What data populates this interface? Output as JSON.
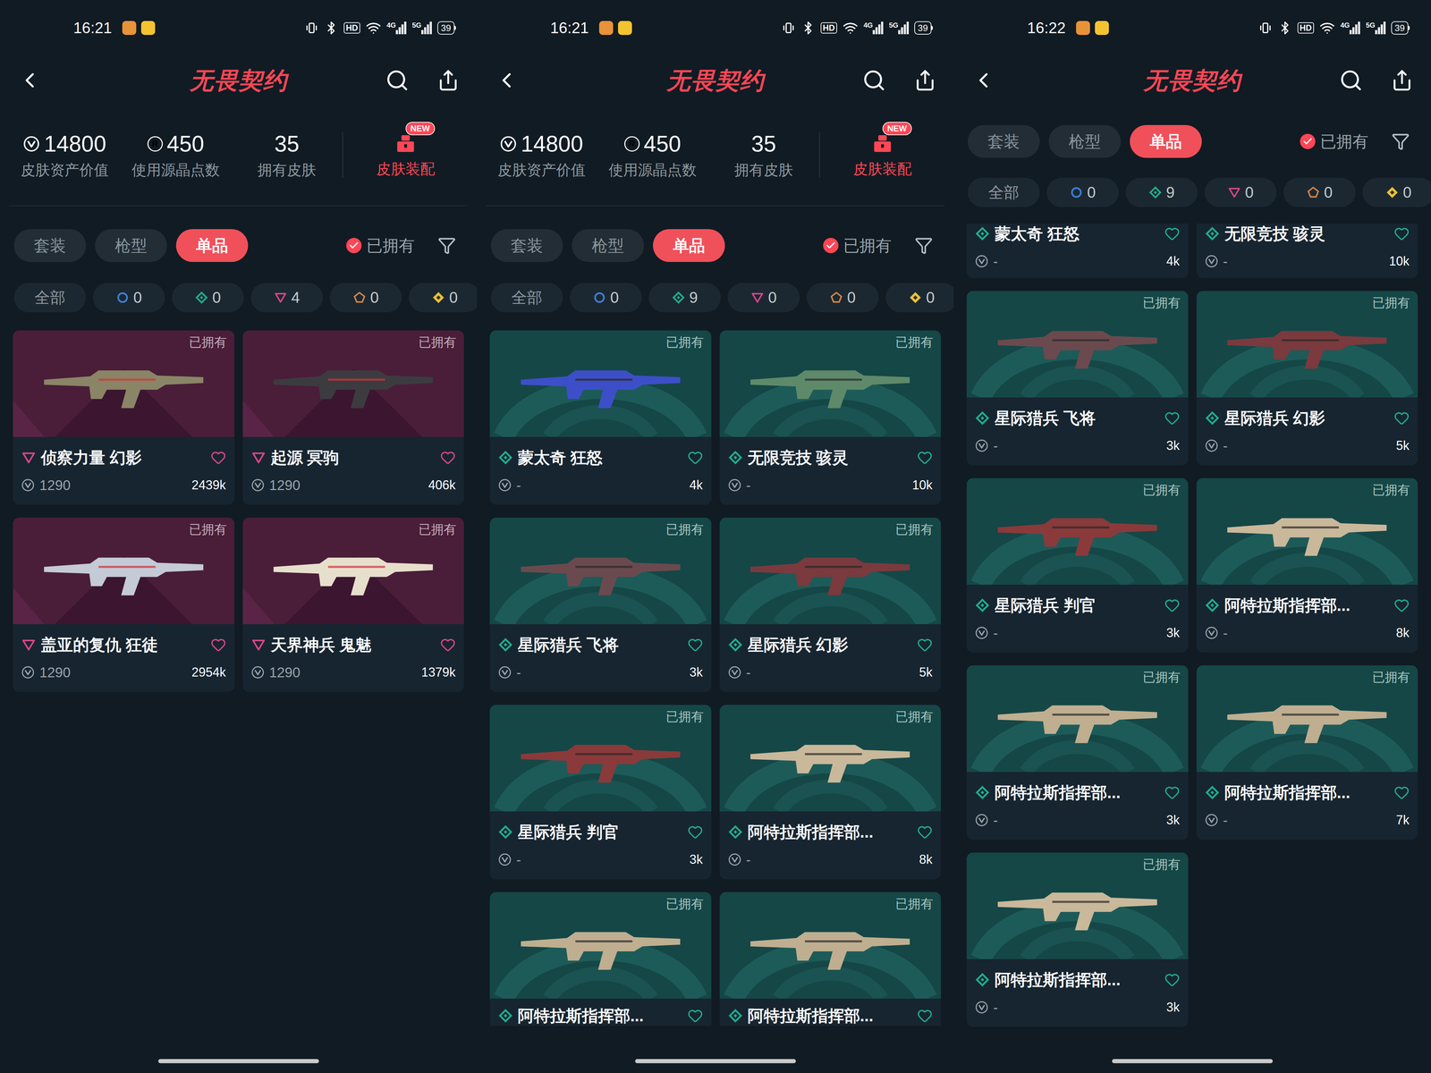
{
  "panels": [
    {
      "status": {
        "time": "16:21",
        "hd": "HD",
        "networks": [
          "4G",
          "5G"
        ],
        "battery": "39"
      },
      "title": "无畏契约",
      "stats": [
        {
          "value": "14800",
          "label": "皮肤资产价值",
          "kind": "vp"
        },
        {
          "value": "450",
          "label": "使用源晶点数",
          "kind": "rp",
          "symbol": "R"
        },
        {
          "value": "35",
          "label": "拥有皮肤",
          "kind": "plain"
        }
      ],
      "loadout": {
        "label": "皮肤装配",
        "badge": "NEW"
      },
      "tabs": [
        {
          "label": "套装",
          "selected": false
        },
        {
          "label": "枪型",
          "selected": false
        },
        {
          "label": "单品",
          "selected": true
        }
      ],
      "owned_filter": {
        "label": "已拥有",
        "checked": true
      },
      "tiers": [
        {
          "label": "全部",
          "kind": "all"
        },
        {
          "label": "0",
          "kind": "select",
          "color": "#3f7fd6"
        },
        {
          "label": "0",
          "kind": "deluxe",
          "color": "#1fae8a"
        },
        {
          "label": "4",
          "kind": "premium",
          "color": "#d9468a"
        },
        {
          "label": "0",
          "kind": "exclusive",
          "color": "#d8864a"
        },
        {
          "label": "0",
          "kind": "ultra",
          "color": "#e8c23a"
        }
      ],
      "cards": [
        {
          "name": "侦察力量 幻影",
          "tier": "premium",
          "kind": "full",
          "badge": "已拥有",
          "price": "1290",
          "likes": "2439k",
          "color": "#8a8566"
        },
        {
          "name": "起源 冥驹",
          "tier": "premium",
          "kind": "full",
          "badge": "已拥有",
          "price": "1290",
          "likes": "406k",
          "color": "#3c3c40"
        },
        {
          "name": "盖亚的复仇 狂徒",
          "tier": "premium",
          "kind": "full",
          "badge": "已拥有",
          "price": "1290",
          "likes": "2954k",
          "color": "#c4cad6"
        },
        {
          "name": "天界神兵 鬼魅",
          "tier": "premium",
          "kind": "full",
          "badge": "已拥有",
          "price": "1290",
          "likes": "1379k",
          "color": "#e6dfcc"
        }
      ]
    },
    {
      "status": {
        "time": "16:21",
        "hd": "HD",
        "networks": [
          "4G",
          "5G"
        ],
        "battery": "39"
      },
      "title": "无畏契约",
      "stats": [
        {
          "value": "14800",
          "label": "皮肤资产价值",
          "kind": "vp"
        },
        {
          "value": "450",
          "label": "使用源晶点数",
          "kind": "rp",
          "symbol": "R"
        },
        {
          "value": "35",
          "label": "拥有皮肤",
          "kind": "plain"
        }
      ],
      "loadout": {
        "label": "皮肤装配",
        "badge": "NEW"
      },
      "tabs": [
        {
          "label": "套装",
          "selected": false
        },
        {
          "label": "枪型",
          "selected": false
        },
        {
          "label": "单品",
          "selected": true
        }
      ],
      "owned_filter": {
        "label": "已拥有",
        "checked": true
      },
      "tiers": [
        {
          "label": "全部",
          "kind": "all"
        },
        {
          "label": "0",
          "kind": "select",
          "color": "#3f7fd6"
        },
        {
          "label": "9",
          "kind": "deluxe",
          "color": "#1fae8a"
        },
        {
          "label": "0",
          "kind": "premium",
          "color": "#d9468a"
        },
        {
          "label": "0",
          "kind": "exclusive",
          "color": "#d8864a"
        },
        {
          "label": "0",
          "kind": "ultra",
          "color": "#e8c23a"
        }
      ],
      "cards": [
        {
          "name": "蒙太奇 狂怒",
          "tier": "deluxe",
          "kind": "full",
          "badge": "已拥有",
          "price": "-",
          "likes": "4k",
          "color": "#3c4fc8"
        },
        {
          "name": "无限竞技 骇灵",
          "tier": "deluxe",
          "kind": "full",
          "badge": "已拥有",
          "price": "-",
          "likes": "10k",
          "color": "#5e8a6a"
        },
        {
          "name": "星际猎兵 飞将",
          "tier": "deluxe",
          "kind": "full",
          "badge": "已拥有",
          "price": "-",
          "likes": "3k",
          "color": "#6a4a4e"
        },
        {
          "name": "星际猎兵 幻影",
          "tier": "deluxe",
          "kind": "full",
          "badge": "已拥有",
          "price": "-",
          "likes": "5k",
          "color": "#7a3a3e"
        },
        {
          "name": "星际猎兵 判官",
          "tier": "deluxe",
          "kind": "full",
          "badge": "已拥有",
          "price": "-",
          "likes": "3k",
          "color": "#8a3a3a"
        },
        {
          "name": "阿特拉斯指挥部...",
          "tier": "deluxe",
          "kind": "full",
          "badge": "已拥有",
          "price": "-",
          "likes": "8k",
          "color": "#c9b89a"
        },
        {
          "name": "阿特拉斯指挥部...",
          "tier": "deluxe",
          "kind": "clipped-bottom",
          "badge": "已拥有",
          "color": "#bfae90"
        },
        {
          "name": "阿特拉斯指挥部...",
          "tier": "deluxe",
          "kind": "clipped-bottom",
          "badge": "已拥有",
          "color": "#bfae90"
        }
      ]
    },
    {
      "status": {
        "time": "16:22",
        "hd": "HD",
        "networks": [
          "4G",
          "5G"
        ],
        "battery": "39"
      },
      "title": "无畏契约",
      "tabs": [
        {
          "label": "套装",
          "selected": false
        },
        {
          "label": "枪型",
          "selected": false
        },
        {
          "label": "单品",
          "selected": true
        }
      ],
      "owned_filter": {
        "label": "已拥有",
        "checked": true
      },
      "tiers": [
        {
          "label": "全部",
          "kind": "all"
        },
        {
          "label": "0",
          "kind": "select",
          "color": "#3f7fd6"
        },
        {
          "label": "9",
          "kind": "deluxe",
          "color": "#1fae8a"
        },
        {
          "label": "0",
          "kind": "premium",
          "color": "#d9468a"
        },
        {
          "label": "0",
          "kind": "exclusive",
          "color": "#d8864a"
        },
        {
          "label": "0",
          "kind": "ultra",
          "color": "#e8c23a"
        }
      ],
      "cards": [
        {
          "name": "蒙太奇 狂怒",
          "tier": "deluxe",
          "kind": "clipped-top",
          "price": "-",
          "likes": "4k"
        },
        {
          "name": "无限竞技 骇灵",
          "tier": "deluxe",
          "kind": "clipped-top",
          "price": "-",
          "likes": "10k"
        },
        {
          "name": "星际猎兵 飞将",
          "tier": "deluxe",
          "kind": "full",
          "badge": "已拥有",
          "price": "-",
          "likes": "3k",
          "color": "#6a4a4e"
        },
        {
          "name": "星际猎兵 幻影",
          "tier": "deluxe",
          "kind": "full",
          "badge": "已拥有",
          "price": "-",
          "likes": "5k",
          "color": "#7a3a3e"
        },
        {
          "name": "星际猎兵 判官",
          "tier": "deluxe",
          "kind": "full",
          "badge": "已拥有",
          "price": "-",
          "likes": "3k",
          "color": "#8a3a3a"
        },
        {
          "name": "阿特拉斯指挥部...",
          "tier": "deluxe",
          "kind": "full",
          "badge": "已拥有",
          "price": "-",
          "likes": "8k",
          "color": "#c9b89a"
        },
        {
          "name": "阿特拉斯指挥部...",
          "tier": "deluxe",
          "kind": "full",
          "badge": "已拥有",
          "price": "-",
          "likes": "3k",
          "color": "#bfae90"
        },
        {
          "name": "阿特拉斯指挥部...",
          "tier": "deluxe",
          "kind": "full",
          "badge": "已拥有",
          "price": "-",
          "likes": "7k",
          "color": "#bfae90"
        },
        {
          "name": "阿特拉斯指挥部...",
          "tier": "deluxe",
          "kind": "full",
          "badge": "已拥有",
          "price": "-",
          "likes": "3k",
          "color": "#c9b89a"
        }
      ]
    }
  ]
}
